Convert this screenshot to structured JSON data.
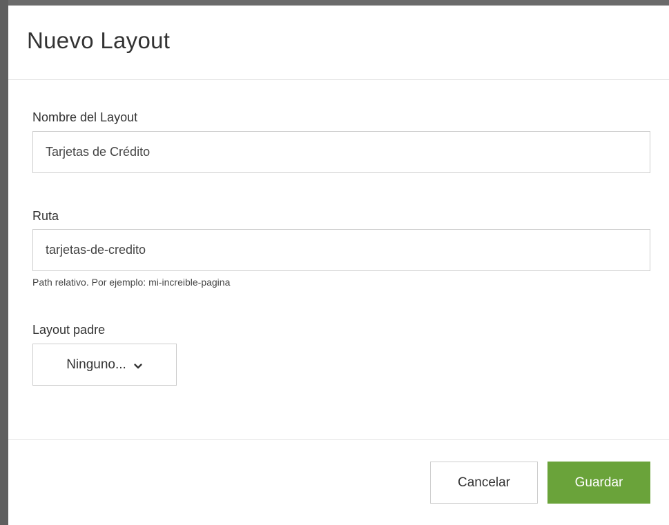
{
  "modal": {
    "title": "Nuevo Layout"
  },
  "form": {
    "name_label": "Nombre del Layout",
    "name_value": "Tarjetas de Crédito",
    "route_label": "Ruta",
    "route_value": "tarjetas-de-credito",
    "route_help": "Path relativo. Por ejemplo: mi-increible-pagina",
    "parent_label": "Layout padre",
    "parent_selected": "Ninguno..."
  },
  "footer": {
    "cancel_label": "Cancelar",
    "save_label": "Guardar"
  },
  "colors": {
    "primary": "#6aa33a",
    "border": "#cccccc",
    "text": "#333333"
  },
  "icons": {
    "select_chevron": "chevron-down-icon"
  }
}
